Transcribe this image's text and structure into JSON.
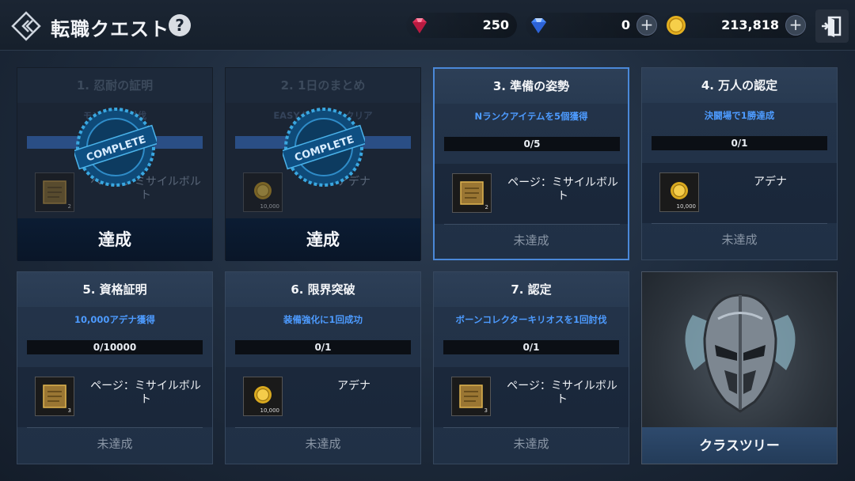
{
  "header": {
    "title": "転職クエスト",
    "help": "?",
    "currencies": {
      "ruby": "250",
      "gem": "0",
      "gold": "213,818"
    },
    "plus": "+"
  },
  "quests": [
    {
      "title": "1. 忍耐の証明",
      "desc": "モンスター討伐",
      "item_qty": "2",
      "item_name": "ページ：ミサイルボルト",
      "status": "達成"
    },
    {
      "title": "2. 1日のまとめ",
      "desc": "EASYダンジョンクリア",
      "item_qty": "10,000",
      "item_name": "アデナ",
      "status": "達成"
    },
    {
      "title": "3. 準備の姿勢",
      "desc": "Nランクアイテムを5個獲得",
      "progress": "0/5",
      "item_qty": "2",
      "item_name": "ページ：ミサイルボルト",
      "status": "未達成"
    },
    {
      "title": "4. 万人の認定",
      "desc": "決闘場で1勝達成",
      "progress": "0/1",
      "item_qty": "10,000",
      "item_name": "アデナ",
      "status": "未達成"
    },
    {
      "title": "5. 資格証明",
      "desc": "10,000アデナ獲得",
      "progress": "0/10000",
      "item_qty": "3",
      "item_name": "ページ：ミサイルボルト",
      "status": "未達成"
    },
    {
      "title": "6. 限界突破",
      "desc": "装備強化に1回成功",
      "progress": "0/1",
      "item_qty": "10,000",
      "item_name": "アデナ",
      "status": "未達成"
    },
    {
      "title": "7. 認定",
      "desc": "ボーンコレクターキリオスを1回討伐",
      "progress": "0/1",
      "item_qty": "3",
      "item_name": "ページ：ミサイルボルト",
      "status": "未達成"
    }
  ],
  "stamp_text": "COMPLETE",
  "class_tree": {
    "label": "クラスツリー"
  },
  "colors": {
    "accent": "#4d9bff",
    "selected_border": "#4a88d8"
  }
}
